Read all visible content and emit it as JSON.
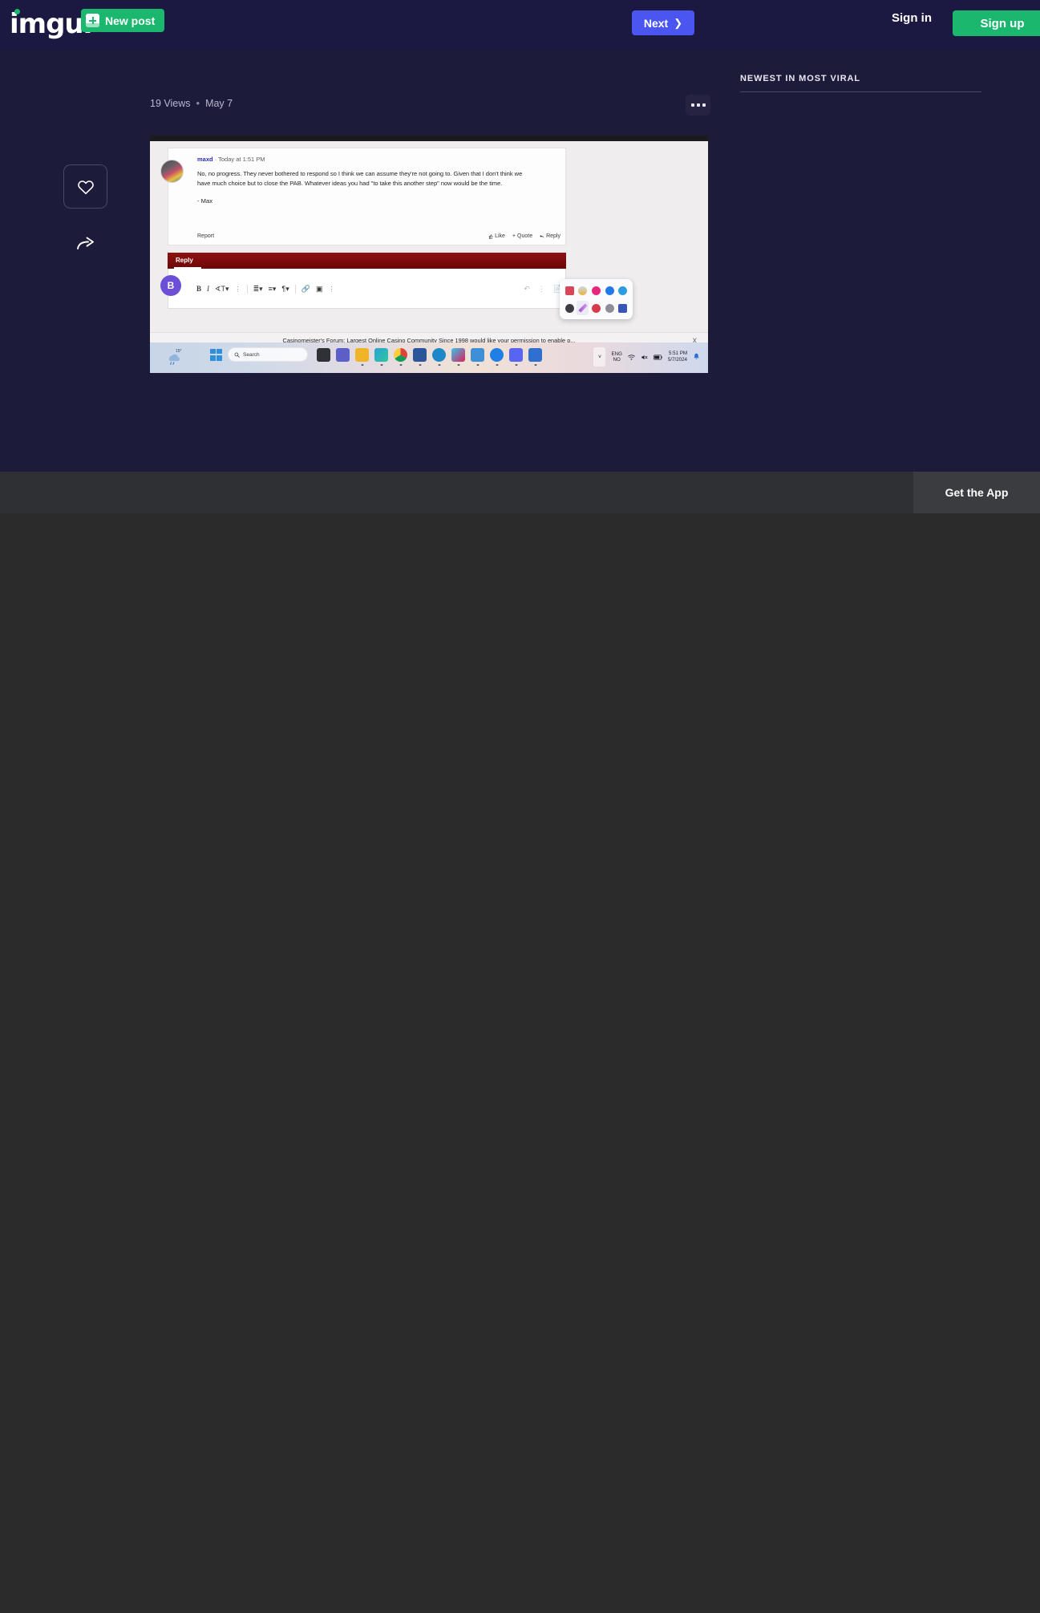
{
  "header": {
    "logo": "imgur",
    "new_post_label": "New post",
    "new_post_icon": "plus-square-icon",
    "next_label": "Next",
    "next_icon": "chevron-right-icon",
    "sign_in_label": "Sign in",
    "sign_up_label": "Sign up",
    "colors": {
      "bg": "#1b1942",
      "green": "#1bb76e",
      "blue": "#4b56f0"
    }
  },
  "post": {
    "views": "19 Views",
    "separator": "•",
    "date": "May 7",
    "more_icon": "ellipsis-icon",
    "favorite_icon": "heart-icon",
    "share_icon": "share-arrow-icon"
  },
  "screenshot": {
    "forum_post": {
      "username": "maxd",
      "timestamp": "· Today at 1:51 PM",
      "body_line_1": "No, no progress. They never bothered to respond so I think we can assume they're not going to. Given that I don't think we",
      "body_line_2": "have much choice but to close the PAB. Whatever ideas you had \"to take this another step\" now would be the time.",
      "signature": "- Max",
      "report_label": "Report",
      "like_label": "Like",
      "like_icon": "thumbs-up-icon",
      "quote_label": "Quote",
      "quote_icon": "plus-icon",
      "reply_label": "Reply",
      "reply_icon": "reply-arrow-icon"
    },
    "editor": {
      "tab_label": "Reply",
      "avatar_letter": "B",
      "tools": [
        {
          "name": "bold-icon",
          "glyph": "B"
        },
        {
          "name": "italic-icon",
          "glyph": "I"
        },
        {
          "name": "font-size-icon",
          "glyph": "ᴛT"
        },
        {
          "name": "more-text-options-icon",
          "glyph": "⋮"
        },
        {
          "name": "bullet-list-icon",
          "glyph": "≡"
        },
        {
          "name": "align-icon",
          "glyph": "≡"
        },
        {
          "name": "paragraph-icon",
          "glyph": "¶"
        },
        {
          "name": "link-icon",
          "glyph": "🔗"
        },
        {
          "name": "image-icon",
          "glyph": "▣"
        },
        {
          "name": "more-insert-options-icon",
          "glyph": "⋮"
        }
      ],
      "undo_icon": "undo-icon",
      "overflow_icon": "vertical-dots-icon",
      "attach_icon": "attach-icon"
    },
    "float_panel": {
      "name": "app-launcher-panel",
      "row1": [
        "calendar-icon",
        "weather-icon",
        "music-icon",
        "bluetooth-icon",
        "maps-icon"
      ],
      "row2": [
        "cloud-icon",
        "pen-icon",
        "photos-icon",
        "settings-icon",
        "notes-icon"
      ],
      "row1_colors": [
        "#d6465a",
        "#e8b33c",
        "#e5277e",
        "#2079e8",
        "#2e9be0"
      ],
      "row2_colors": [
        "#3c3c46",
        "#9a4fd6",
        "#d63a4b",
        "#8e8e98",
        "#3a55b8"
      ]
    },
    "permission_bar": {
      "text": "Casinomeister's Forum: Largest Online Casino Community Since 1998 would like your permission to enable p...",
      "close_icon": "close-x-icon",
      "close_label": "X"
    },
    "taskbar": {
      "weather_temp": "15°",
      "weather_icon": "rain-cloud-icon",
      "start_icon": "windows-start-icon",
      "search_placeholder": "Search",
      "search_icon": "search-icon",
      "apps": [
        {
          "name": "file-explorer-icon",
          "color": "#2f3137"
        },
        {
          "name": "teams-icon",
          "color": "#5b5fc7"
        },
        {
          "name": "explorer-folder-icon",
          "color": "#f0b429"
        },
        {
          "name": "edge-icon",
          "color": "#2aa3d4"
        },
        {
          "name": "chrome-icon",
          "color": "#3ba55d"
        },
        {
          "name": "word-icon",
          "color": "#2b579a"
        },
        {
          "name": "compass-icon",
          "color": "#1e88c7"
        },
        {
          "name": "slack-icon",
          "color": "#dd4b66"
        },
        {
          "name": "usb-device-icon",
          "color": "#3e8fd6"
        },
        {
          "name": "messenger-icon",
          "color": "#1f7fe5"
        },
        {
          "name": "discord-icon",
          "color": "#5865f2"
        },
        {
          "name": "sketch-icon",
          "color": "#2f6fd0"
        }
      ],
      "tray": {
        "chevron_icon": "chevron-up-icon",
        "language_line1": "ENG",
        "language_line2": "NO",
        "wifi_icon": "wifi-icon",
        "volume_icon": "volume-mute-icon",
        "battery_icon": "battery-icon",
        "time": "5:51 PM",
        "date": "5/7/2024",
        "notification_icon": "bell-icon"
      }
    }
  },
  "sidebar": {
    "title": "NEWEST IN MOST VIRAL"
  },
  "appbar": {
    "get_app_label": "Get the App"
  }
}
